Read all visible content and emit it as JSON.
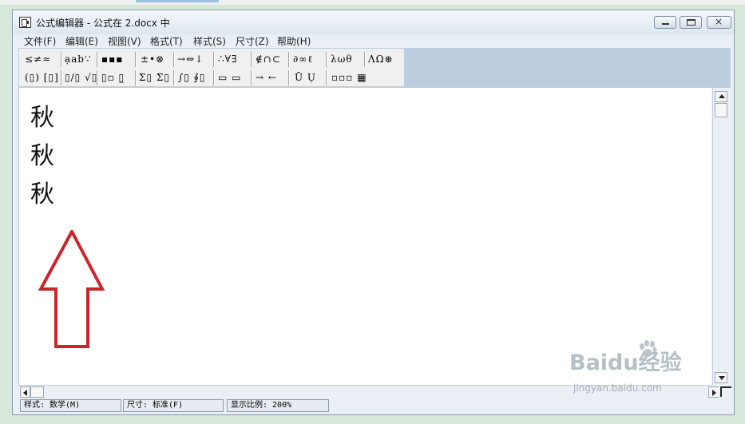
{
  "window": {
    "title": "公式编辑器 - 公式在 2.docx 中",
    "controls": {
      "minimize": "minimize-icon",
      "maximize": "maximize-icon",
      "close": "×"
    }
  },
  "menu": [
    "文件(F)",
    "编辑(E)",
    "视图(V)",
    "格式(T)",
    "样式(S)",
    "尺寸(Z)",
    "帮助(H)"
  ],
  "toolbar": {
    "row1": [
      "≤≠≈",
      "ạab∵",
      "▪▪▪",
      "±•⊗",
      "→⇔↓",
      "∴∀∃",
      "∉∩⊂",
      "∂∞ℓ",
      "λωθ",
      "ΛΩ⊛"
    ],
    "row2": [
      "(▯) [▯]",
      "▯/▯ √▯",
      "▯▫ ▯̲",
      "Σ▯ Σ▯",
      "∫▯ ∮▯",
      "▭ ▭",
      "→ ←",
      "Ū Ụ",
      "▫▫▫ ▦"
    ]
  },
  "editor": {
    "lines": [
      "秋",
      "秋",
      "秋"
    ],
    "annotation": "red-up-arrow",
    "accent_color": "#c8262c"
  },
  "status": {
    "style": "样式: 数学(M)",
    "size": "尺寸: 标准(F)",
    "zoom": "显示比例: 200%"
  },
  "watermark": {
    "logo": "Baidu经验",
    "url": "jingyan.baidu.com"
  }
}
